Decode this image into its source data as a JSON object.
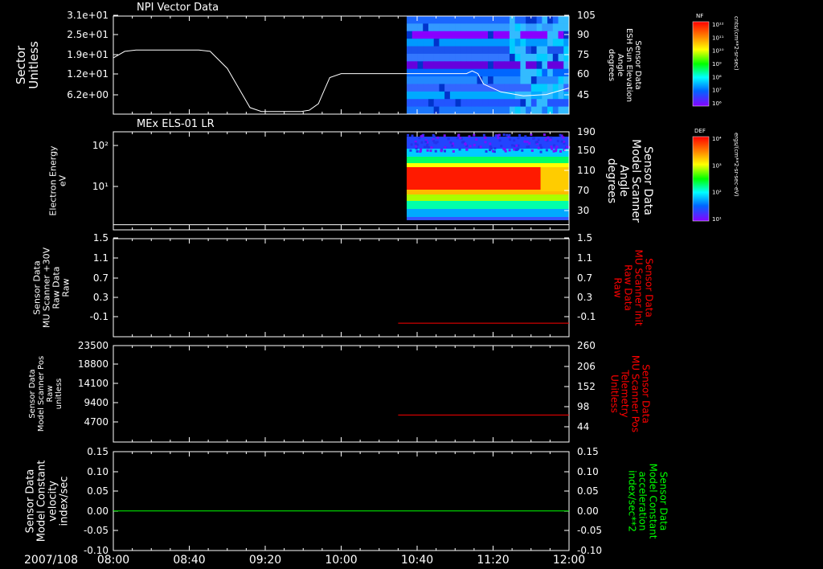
{
  "time_axis": {
    "date_label": "2007/108",
    "ticks": [
      "08:00",
      "08:40",
      "09:20",
      "10:00",
      "10:40",
      "11:20",
      "12:00"
    ],
    "tick_hours": [
      8.0,
      8.6667,
      9.3333,
      10.0,
      10.6667,
      11.3333,
      12.0
    ],
    "range_hours": [
      8.0,
      12.0
    ]
  },
  "panels": [
    {
      "id": "npi",
      "title": "NPI Vector Data",
      "left_label": [
        "Sector",
        "Unitless"
      ],
      "right_label": [
        "Sensor Data",
        "ESH Sun Elevation",
        "Angle",
        "degrees"
      ],
      "left_ticks": [
        "3.1e+01",
        "2.5e+01",
        "1.9e+01",
        "1.2e+01",
        "6.2e+00"
      ],
      "right_ticks": [
        "105",
        "90",
        "75",
        "60",
        "45"
      ],
      "label_color": "#ffffff",
      "colorbar": {
        "label": "NF",
        "unit": "cnts/(cm**2-sr-sec)",
        "ticks": [
          "10¹²",
          "10¹¹",
          "10¹⁰",
          "10⁹",
          "10⁸",
          "10⁷",
          "10⁶"
        ]
      }
    },
    {
      "id": "els",
      "title": "MEx ELS-01 LR",
      "left_label": [
        "Electron Energy",
        "eV"
      ],
      "right_label": [
        "Sensor Data",
        "Model Scanner",
        "Angle",
        "degrees"
      ],
      "left_ticks": [
        "10²",
        "10¹"
      ],
      "right_ticks": [
        "190",
        "150",
        "110",
        "70",
        "30"
      ],
      "label_color": "#ffffff",
      "colorbar": {
        "label": "DEF",
        "unit": "ergs/(cm**2-sr-sec-eV)",
        "ticks": [
          "10⁴",
          "10³",
          "10²",
          "10¹"
        ]
      }
    },
    {
      "id": "mu_raw",
      "left_label": [
        "Sensor Data",
        "MU Scanner +30V",
        "Raw Data",
        "Raw"
      ],
      "right_label": [
        "Sensor Data",
        "MU Scanner Init",
        "Raw Data",
        "Raw"
      ],
      "left_ticks": [
        "1.5",
        "1.1",
        "0.7",
        "0.3",
        "-0.1"
      ],
      "right_ticks": [
        "1.5",
        "1.1",
        "0.7",
        "0.3",
        "-0.1"
      ],
      "label_color": "#ffffff",
      "right_label_color": "#ff0000"
    },
    {
      "id": "mu_pos",
      "left_label": [
        "Sensor Data",
        "Model Scanner Pos",
        "Raw",
        "unitless"
      ],
      "right_label": [
        "Sensor Data",
        "MU Scanner Pos",
        "Telemetry",
        "Unitless"
      ],
      "left_ticks": [
        "23500",
        "18800",
        "14100",
        "9400",
        "4700"
      ],
      "right_ticks": [
        "260",
        "206",
        "152",
        "98",
        "44"
      ],
      "label_color": "#ffffff",
      "right_label_color": "#ff0000"
    },
    {
      "id": "model_const",
      "left_label": [
        "Sensor Data",
        "Model Constant",
        "velocity",
        "index/sec"
      ],
      "right_label": [
        "Sensor Data",
        "Model Constant",
        "acceleration",
        "index/sec**2"
      ],
      "left_ticks": [
        "0.15",
        "0.10",
        "0.05",
        "0.00",
        "-0.05",
        "-0.10"
      ],
      "right_ticks": [
        "0.15",
        "0.10",
        "0.05",
        "0.00",
        "-0.05",
        "-0.10"
      ],
      "label_color": "#ffffff",
      "right_label_color": "#00ff00"
    }
  ],
  "chart_data": [
    {
      "type": "line",
      "panel": "npi",
      "name": "ESH Sun Elevation Angle",
      "axis": "right",
      "ylim": [
        30,
        105
      ],
      "x_hours": [
        8.0,
        8.1,
        8.2,
        8.3,
        8.45,
        8.6,
        8.75,
        8.85,
        9.0,
        9.1,
        9.2,
        9.3,
        9.5,
        9.65,
        9.72,
        9.8,
        9.85,
        9.9,
        10.0,
        10.2,
        10.4,
        10.6,
        10.8,
        11.0,
        11.1,
        11.15,
        11.2,
        11.25,
        11.4,
        11.6,
        11.8,
        12.0
      ],
      "y": [
        73,
        78,
        79,
        79,
        79,
        79,
        79,
        78,
        65,
        50,
        35,
        32,
        32,
        32,
        33,
        38,
        48,
        58,
        61,
        61,
        61,
        61,
        61,
        61,
        61,
        63,
        61,
        53,
        47,
        44,
        45,
        50
      ],
      "color": "#ffffff"
    },
    {
      "type": "heatmap",
      "panel": "npi",
      "name": "NF",
      "x_start_hours": 10.575,
      "x_end_hours": 12.0,
      "color": "spectrogram"
    },
    {
      "type": "line",
      "panel": "els",
      "name": "Model Scanner Angle",
      "axis": "right",
      "ylim": [
        0,
        190
      ],
      "x_hours": [
        8.0,
        12.0
      ],
      "y": [
        10,
        10
      ],
      "color": "#ffffff"
    },
    {
      "type": "heatmap",
      "panel": "els",
      "name": "DEF",
      "x_start_hours": 10.575,
      "x_end_hours": 12.0,
      "color": "spectrogram"
    },
    {
      "type": "line",
      "panel": "mu_raw",
      "name": "MU Scanner Init Raw",
      "axis": "right",
      "ylim": [
        -0.3,
        1.5
      ],
      "x_hours": [
        10.5,
        12.0
      ],
      "y": [
        -0.05,
        -0.05
      ],
      "color": "#ff0000"
    },
    {
      "type": "line",
      "panel": "mu_pos",
      "name": "MU Scanner Pos Telemetry",
      "axis": "right",
      "ylim": [
        17,
        260
      ],
      "x_hours": [
        10.5,
        12.0
      ],
      "y": [
        85,
        85
      ],
      "color": "#ff0000"
    },
    {
      "type": "line",
      "panel": "model_const",
      "name": "Model Constant velocity",
      "axis": "left",
      "ylim": [
        -0.1,
        0.15
      ],
      "x_hours": [
        8.0,
        12.0
      ],
      "y": [
        0.0,
        0.0
      ],
      "color": "#00ff00"
    }
  ]
}
